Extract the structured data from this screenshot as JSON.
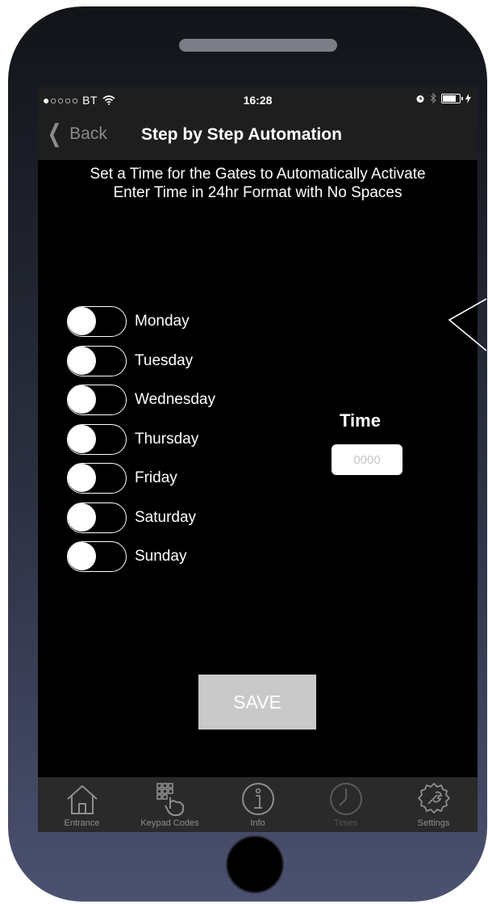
{
  "status_bar": {
    "carrier": "●○○○○ BT",
    "time": "16:28"
  },
  "nav": {
    "back_label": "Back",
    "title": "Step by Step Automation"
  },
  "instructions": {
    "line1": "Set a Time for the Gates to Automatically Activate",
    "line2": "Enter Time in 24hr Format with No Spaces"
  },
  "days": [
    {
      "label": "Monday",
      "enabled": false
    },
    {
      "label": "Tuesday",
      "enabled": false
    },
    {
      "label": "Wednesday",
      "enabled": false
    },
    {
      "label": "Thursday",
      "enabled": false
    },
    {
      "label": "Friday",
      "enabled": false
    },
    {
      "label": "Saturday",
      "enabled": false
    },
    {
      "label": "Sunday",
      "enabled": false
    }
  ],
  "time": {
    "label": "Time",
    "value": "",
    "placeholder": "0000"
  },
  "save_label": "SAVE",
  "tabs": [
    {
      "label": "Entrance",
      "icon": "home-icon"
    },
    {
      "label": "Keypad Codes",
      "icon": "keypad-icon"
    },
    {
      "label": "Info",
      "icon": "info-icon"
    },
    {
      "label": "Times",
      "icon": "clock-icon"
    },
    {
      "label": "Settings",
      "icon": "settings-icon"
    }
  ],
  "colors": {
    "screen_bg": "#000000",
    "bar_bg": "#1e1e1e",
    "tab_bar_bg": "#2a2a2a",
    "save_button_bg": "#c9c9c9",
    "toggle_knob": "#ffffff"
  }
}
